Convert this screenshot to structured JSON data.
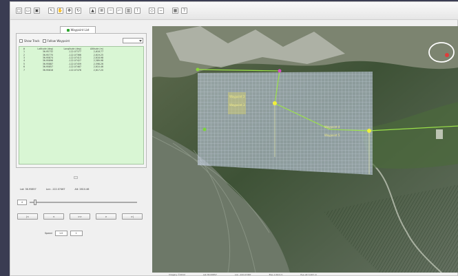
{
  "toolbar": {
    "buttons": [
      {
        "icon": "new-file-icon",
        "glyph": "□"
      },
      {
        "icon": "open-icon",
        "glyph": "▭"
      },
      {
        "icon": "save-icon",
        "glyph": "▣"
      },
      {
        "icon": "pointer-icon",
        "glyph": "↖"
      },
      {
        "icon": "hand-icon",
        "glyph": "✋"
      },
      {
        "icon": "move-icon",
        "glyph": "✥"
      },
      {
        "icon": "rotate-icon",
        "glyph": "↻"
      },
      {
        "icon": "mountain-icon",
        "glyph": "▲"
      },
      {
        "icon": "layers-icon",
        "glyph": "≣"
      },
      {
        "icon": "line-icon",
        "glyph": "─"
      },
      {
        "icon": "path-icon",
        "glyph": "⌐"
      },
      {
        "icon": "chart-icon",
        "glyph": "▥"
      },
      {
        "icon": "pin-icon",
        "glyph": "!"
      },
      {
        "icon": "tilt-icon",
        "glyph": "◇"
      },
      {
        "icon": "minus-icon",
        "glyph": "−"
      },
      {
        "icon": "grid-icon",
        "glyph": "▦"
      },
      {
        "icon": "help-icon",
        "glyph": "?"
      }
    ]
  },
  "panel": {
    "tab_label": "Waypoint List",
    "options": [
      {
        "label": "Show Track"
      },
      {
        "label": "Follow Waypoint"
      }
    ],
    "table": {
      "columns": [
        "#",
        "Latitude (deg)",
        "Longitude (deg)",
        "Altitude (m)"
      ],
      "rows": [
        [
          "1",
          "36.95732",
          "-122.07377",
          "2,618.77"
        ],
        [
          "2",
          "36.95770",
          "-122.07366",
          "2,619.25"
        ],
        [
          "3",
          "36.95874",
          "-122.07413",
          "2,618.98"
        ],
        [
          "4",
          "36.95896",
          "-122.07427",
          "2,589.98"
        ],
        [
          "5",
          "36.95887",
          "-122.07459",
          "2,598.26"
        ],
        [
          "6",
          "36.95857",
          "-122.07467",
          "2,610.46"
        ],
        [
          "7",
          "36.95816",
          "-122.07476",
          "2,617.20"
        ]
      ]
    },
    "coords": {
      "lat": "Lat: 36.95857",
      "lon": "Lon: -122.07467",
      "alt": "Alt: 2610.46"
    },
    "slider": {
      "spin_value": "4",
      "position": 0.03
    },
    "nav_buttons": [
      "|<",
      "<",
      ">>",
      ">",
      ">|"
    ],
    "speed": {
      "label": "Speed",
      "value": "1.0",
      "step": "1"
    }
  },
  "map": {
    "labels": [
      "Waypoint 2",
      "Waypoint 3",
      "Waypoint 4",
      "Waypoint 5"
    ]
  },
  "statusbar": {
    "items": [
      "Imagery  ©2012",
      "Lat 36.95857",
      "Lon -122.07467",
      "Elev 2,610 m",
      "Eye alt 3,267 m"
    ]
  }
}
